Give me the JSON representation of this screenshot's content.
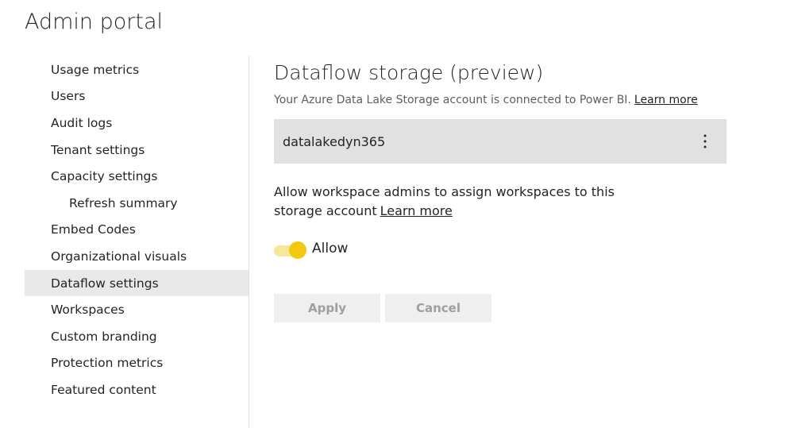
{
  "header": {
    "title": "Admin portal"
  },
  "sidebar": {
    "items": [
      {
        "label": "Usage metrics"
      },
      {
        "label": "Users"
      },
      {
        "label": "Audit logs"
      },
      {
        "label": "Tenant settings"
      },
      {
        "label": "Capacity settings"
      },
      {
        "label": "Refresh summary"
      },
      {
        "label": "Embed Codes"
      },
      {
        "label": "Organizational visuals"
      },
      {
        "label": "Dataflow settings"
      },
      {
        "label": "Workspaces"
      },
      {
        "label": "Custom branding"
      },
      {
        "label": "Protection metrics"
      },
      {
        "label": "Featured content"
      }
    ],
    "selected": "Dataflow settings"
  },
  "main": {
    "title": "Dataflow storage (preview)",
    "subtitle": "Your Azure Data Lake Storage account is connected to Power BI.",
    "subtitle_link": "Learn more",
    "storage_account": "datalakedyn365",
    "allow_text": "Allow workspace admins to assign workspaces to this storage account",
    "allow_link": "Learn more",
    "toggle_label": "Allow",
    "toggle_on": true,
    "apply_label": "Apply",
    "cancel_label": "Cancel"
  },
  "colors": {
    "accent": "#f2c811",
    "selected_bg": "#e9e9e9",
    "card_bg": "#e1e1e1"
  },
  "icons": {
    "more": "more-vertical-icon"
  }
}
